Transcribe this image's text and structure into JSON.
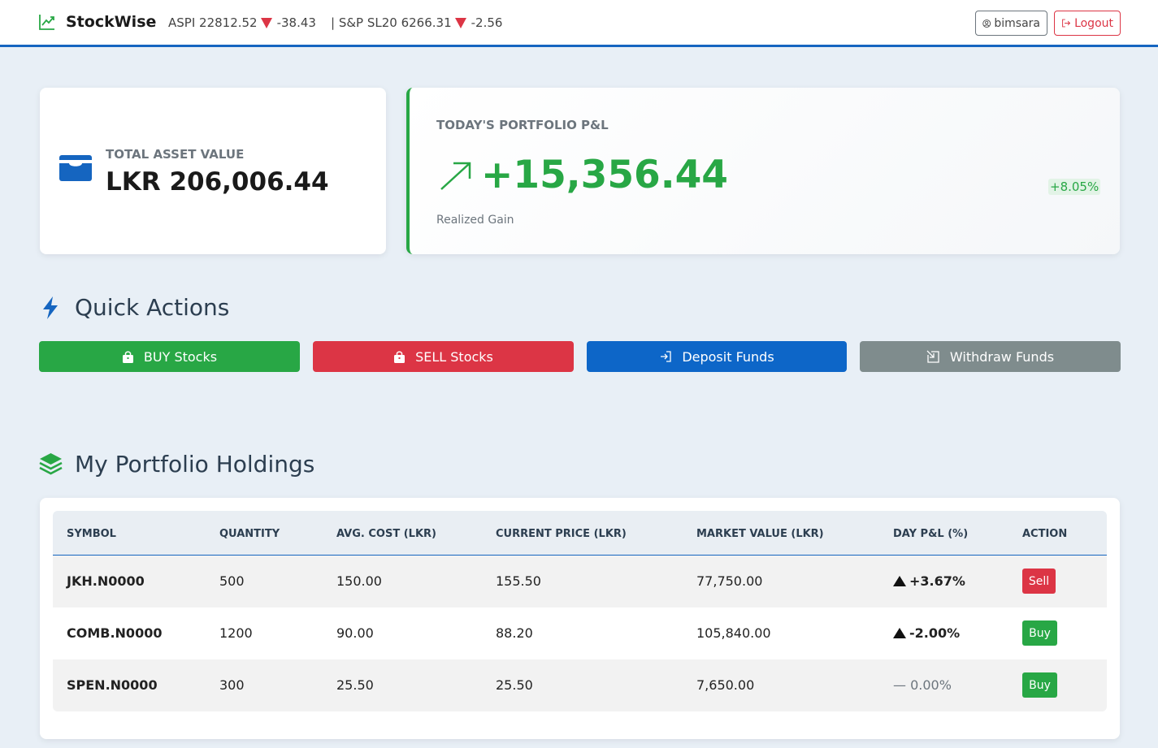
{
  "navbar": {
    "brand": "StockWise",
    "tickers": [
      {
        "name": "ASPI 22812.52",
        "change": "-38.43"
      },
      {
        "name": "| S&P SL20 6266.31",
        "change": "-2.56"
      }
    ],
    "user_label": "bimsara",
    "logout_label": "Logout"
  },
  "asset": {
    "label": "TOTAL ASSET VALUE",
    "value": "LKR 206,006.44"
  },
  "pnl": {
    "label": "TODAY'S PORTFOLIO P&L",
    "value": "+15,356.44",
    "sub": "Realized Gain",
    "badge": "+8.05%"
  },
  "quick_actions": {
    "title": "Quick Actions",
    "buttons": [
      {
        "label": "BUY Stocks",
        "color": "#28a745",
        "icon": "bag-icon"
      },
      {
        "label": "SELL Stocks",
        "color": "#dc3545",
        "icon": "bag-icon"
      },
      {
        "label": "Deposit Funds",
        "color": "#0d66c8",
        "icon": "login-icon"
      },
      {
        "label": "Withdraw Funds",
        "color": "#7f8c8d",
        "icon": "box-arrow-icon"
      }
    ]
  },
  "holdings": {
    "title": "My Portfolio Holdings",
    "columns": [
      "SYMBOL",
      "QUANTITY",
      "AVG. COST (LKR)",
      "CURRENT PRICE (LKR)",
      "MARKET VALUE (LKR)",
      "DAY P&L (%)",
      "ACTION"
    ],
    "rows": [
      {
        "symbol": "JKH.N0000",
        "quantity": "500",
        "avg_cost": "150.00",
        "current_price": "155.50",
        "market_value": "77,750.00",
        "day_pl": "+3.67%",
        "action": "Sell"
      },
      {
        "symbol": "COMB.N0000",
        "quantity": "1200",
        "avg_cost": "90.00",
        "current_price": "88.20",
        "market_value": "105,840.00",
        "day_pl": "-2.00%",
        "action": "Buy"
      },
      {
        "symbol": "SPEN.N0000",
        "quantity": "300",
        "avg_cost": "25.50",
        "current_price": "25.50",
        "market_value": "7,650.00",
        "day_pl": "— 0.00%",
        "action": "Buy"
      }
    ]
  }
}
